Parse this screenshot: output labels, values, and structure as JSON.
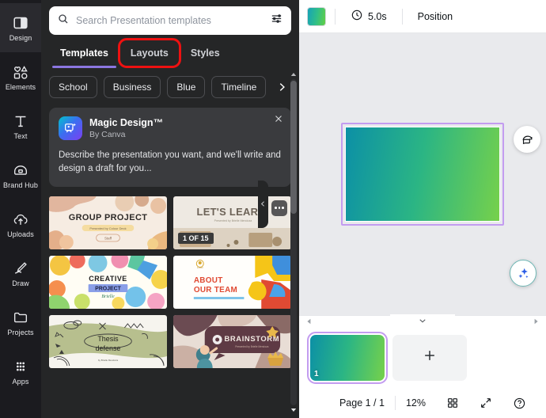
{
  "rail": {
    "items": [
      {
        "label": "Design",
        "icon": "design-icon",
        "active": true
      },
      {
        "label": "Elements",
        "icon": "elements-icon",
        "active": false
      },
      {
        "label": "Text",
        "icon": "text-icon",
        "active": false
      },
      {
        "label": "Brand Hub",
        "icon": "brand-hub-icon",
        "active": false
      },
      {
        "label": "Uploads",
        "icon": "uploads-icon",
        "active": false
      },
      {
        "label": "Draw",
        "icon": "draw-icon",
        "active": false
      },
      {
        "label": "Projects",
        "icon": "projects-icon",
        "active": false
      },
      {
        "label": "Apps",
        "icon": "apps-icon",
        "active": false
      }
    ]
  },
  "search": {
    "placeholder": "Search Presentation templates",
    "value": "",
    "icon": "search-icon",
    "filter_icon": "filter-sliders-icon"
  },
  "tabs": [
    {
      "label": "Templates",
      "active": true,
      "annotated": false
    },
    {
      "label": "Layouts",
      "active": false,
      "annotated": true
    },
    {
      "label": "Styles",
      "active": false,
      "annotated": false
    }
  ],
  "chips": [
    {
      "label": "School"
    },
    {
      "label": "Business"
    },
    {
      "label": "Blue"
    },
    {
      "label": "Timeline"
    }
  ],
  "chips_next_icon": "chevron-right-icon",
  "promo": {
    "title": "Magic Design™",
    "subtitle": "By Canva",
    "body": "Describe the presentation you want, and we'll write and design a draft for you...",
    "close_icon": "close-icon",
    "app_icon": "magic-design-icon"
  },
  "templates": [
    {
      "name": "Group Project",
      "title": "GROUP PROJECT",
      "subtitle": "Presented by Colour Deck",
      "tag": "Staff",
      "badge": "",
      "menu": false
    },
    {
      "name": "Let's Learn",
      "title": "LET'S LEARN!",
      "subtitle": "",
      "tag": "",
      "badge": "1 OF 15",
      "menu": true
    },
    {
      "name": "Creative Project",
      "title": "CREATIVE",
      "subtitle": "PROJECT",
      "tag": "Brielle",
      "badge": "",
      "menu": false
    },
    {
      "name": "About Our Team",
      "title": "ABOUT",
      "subtitle": "OUR TEAM",
      "tag": "",
      "badge": "",
      "menu": false
    },
    {
      "name": "Thesis Defense",
      "title": "Thesis",
      "subtitle": "defense",
      "tag": "",
      "badge": "",
      "menu": false
    },
    {
      "name": "Brainstorm",
      "title": "BRAINSTORM",
      "subtitle": "",
      "tag": "",
      "badge": "",
      "menu": false
    }
  ],
  "panel_collapse_icon": "chevron-left-icon",
  "scrollbar": {
    "up_icon": "caret-up-icon",
    "down_icon": "caret-down-icon"
  },
  "toolbar": {
    "color_swatch": "#2fbe8a",
    "timer_icon": "clock-icon",
    "duration": "5.0s",
    "position_label": "Position"
  },
  "canvas": {
    "gradient_from": "#0c90a6",
    "gradient_to": "#76d14b",
    "selection_color": "#c39cf0",
    "comment_icon": "add-comment-icon",
    "magic_icon": "magic-sparkles-icon"
  },
  "pages_strip": {
    "left_arrow_icon": "caret-left-icon",
    "right_arrow_icon": "caret-right-icon",
    "collapse_icon": "chevron-down-icon",
    "page_number": "1",
    "add_page_icon": "plus-icon"
  },
  "statusbar": {
    "page_label": "Page 1 / 1",
    "zoom_label": "12%",
    "grid_icon": "grid-view-icon",
    "fullscreen_icon": "expand-icon",
    "help_icon": "help-icon"
  }
}
